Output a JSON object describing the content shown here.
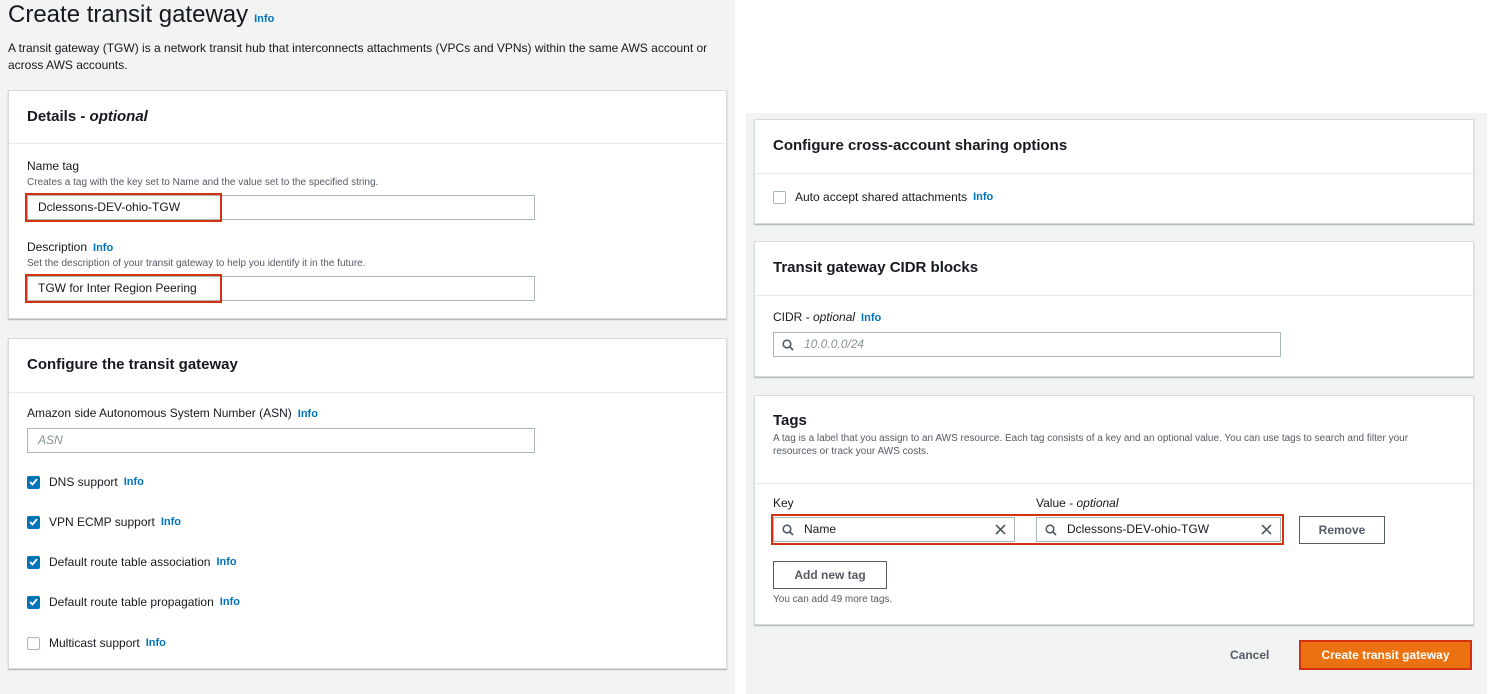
{
  "page": {
    "title": "Create transit gateway",
    "info": "Info",
    "description": "A transit gateway (TGW) is a network transit hub that interconnects attachments (VPCs and VPNs) within the same AWS account or across AWS accounts."
  },
  "details": {
    "header_main": "Details - ",
    "header_optional": "optional",
    "name_tag": {
      "label": "Name tag",
      "description": "Creates a tag with the key set to Name and the value set to the specified string.",
      "value": "Dclessons-DEV-ohio-TGW"
    },
    "description_field": {
      "label": "Description",
      "info": "Info",
      "description": "Set the description of your transit gateway to help you identify it in the future.",
      "value": "TGW for Inter Region Peering"
    }
  },
  "configure": {
    "header": "Configure the transit gateway",
    "asn": {
      "label": "Amazon side Autonomous System Number (ASN)",
      "info": "Info",
      "placeholder": "ASN"
    },
    "options": [
      {
        "label": "DNS support",
        "info": "Info",
        "checked": true
      },
      {
        "label": "VPN ECMP support",
        "info": "Info",
        "checked": true
      },
      {
        "label": "Default route table association",
        "info": "Info",
        "checked": true
      },
      {
        "label": "Default route table propagation",
        "info": "Info",
        "checked": true
      },
      {
        "label": "Multicast support",
        "info": "Info",
        "checked": false
      }
    ]
  },
  "sharing": {
    "header": "Configure cross-account sharing options",
    "auto_accept": {
      "label": "Auto accept shared attachments",
      "info": "Info",
      "checked": false
    }
  },
  "cidr": {
    "header": "Transit gateway CIDR blocks",
    "label_main": "CIDR - ",
    "label_optional": "optional",
    "info": "Info",
    "placeholder": "10.0.0.0/24"
  },
  "tags": {
    "header": "Tags",
    "description": "A tag is a label that you assign to an AWS resource. Each tag consists of a key and an optional value. You can use tags to search and filter your resources or track your AWS costs.",
    "key_label": "Key",
    "value_label_main": "Value - ",
    "value_label_optional": "optional",
    "key_value": "Name",
    "value_value": "Dclessons-DEV-ohio-TGW",
    "remove_label": "Remove",
    "add_label": "Add new tag",
    "remaining": "You can add 49 more tags."
  },
  "footer": {
    "cancel": "Cancel",
    "create": "Create transit gateway"
  },
  "colors": {
    "accent": "#0073bb",
    "primary_button": "#ec7211",
    "highlight": "#d13212"
  }
}
